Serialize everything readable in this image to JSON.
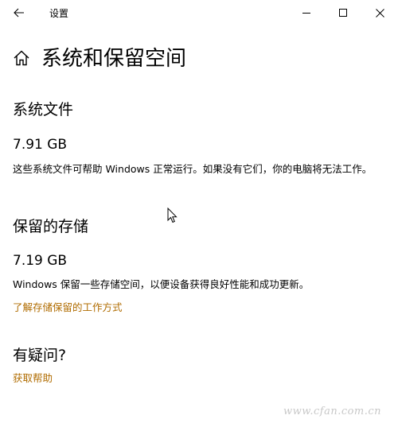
{
  "titlebar": {
    "title": "设置",
    "back_icon": "arrow-left-icon",
    "minimize_icon": "minimize-icon",
    "maximize_icon": "maximize-icon",
    "close_icon": "close-icon"
  },
  "header": {
    "icon": "home-icon",
    "title": "系统和保留空间"
  },
  "system_files": {
    "heading": "系统文件",
    "size": "7.91 GB",
    "description": "这些系统文件可帮助 Windows 正常运行。如果没有它们，你的电脑将无法工作。"
  },
  "reserved_storage": {
    "heading": "保留的存储",
    "size": "7.19 GB",
    "description": "Windows 保留一些存储空间，以便设备获得良好性能和成功更新。",
    "link": "了解存储保留的工作方式"
  },
  "help": {
    "heading": "有疑问?",
    "link": "获取帮助"
  },
  "watermark": "www.cfan.com.cn",
  "colors": {
    "link": "#b06c00",
    "background": "#ffffff",
    "text": "#000000"
  }
}
